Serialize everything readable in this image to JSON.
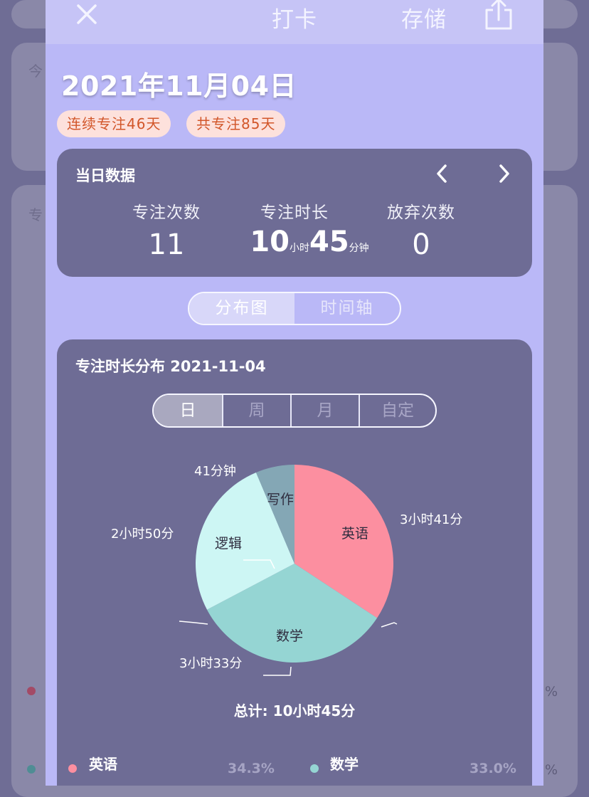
{
  "background": {
    "left_labels": [
      "今",
      "专"
    ],
    "right_pcts": [
      "%",
      "%"
    ]
  },
  "header": {
    "title": "打卡",
    "save_label": "存储"
  },
  "date_title": "2021年11月04日",
  "pills": {
    "streak": "连续专注46天",
    "total": "共专注85天"
  },
  "daily": {
    "title": "当日数据",
    "labels": [
      "专注次数",
      "专注时长",
      "放弃次数"
    ],
    "focus_count": "11",
    "duration_hours": "10",
    "duration_hours_unit": "小时",
    "duration_minutes": "45",
    "duration_minutes_unit": "分钟",
    "give_up_count": "0"
  },
  "view_toggle": {
    "options": [
      "分布图",
      "时间轴"
    ],
    "selected": "分布图"
  },
  "distribution": {
    "title": "专注时长分布 2021-11-04",
    "periods": [
      "日",
      "周",
      "月",
      "自定"
    ],
    "selected_period": "日",
    "total": "总计: 10小时45分"
  },
  "chart_data": {
    "type": "pie",
    "title": "专注时长分布 2021-11-04",
    "unit": "minutes",
    "slices": [
      {
        "name": "英语",
        "value": 221,
        "label": "3小时41分",
        "percent": "34.3%",
        "color": "#fc8fa0"
      },
      {
        "name": "数学",
        "value": 213,
        "label": "3小时33分",
        "percent": "33.0%",
        "color": "#95d5d3"
      },
      {
        "name": "逻辑",
        "value": 170,
        "label": "2小时50分",
        "color": "#cdf6f4"
      },
      {
        "name": "写作",
        "value": 41,
        "label": "41分钟",
        "color": "#84a7b5"
      }
    ]
  },
  "colors": {
    "sheet": "#bab8f7",
    "card": "#6e6c95",
    "pill_bg": "#fde1dc",
    "pill_text": "#d2562a"
  }
}
